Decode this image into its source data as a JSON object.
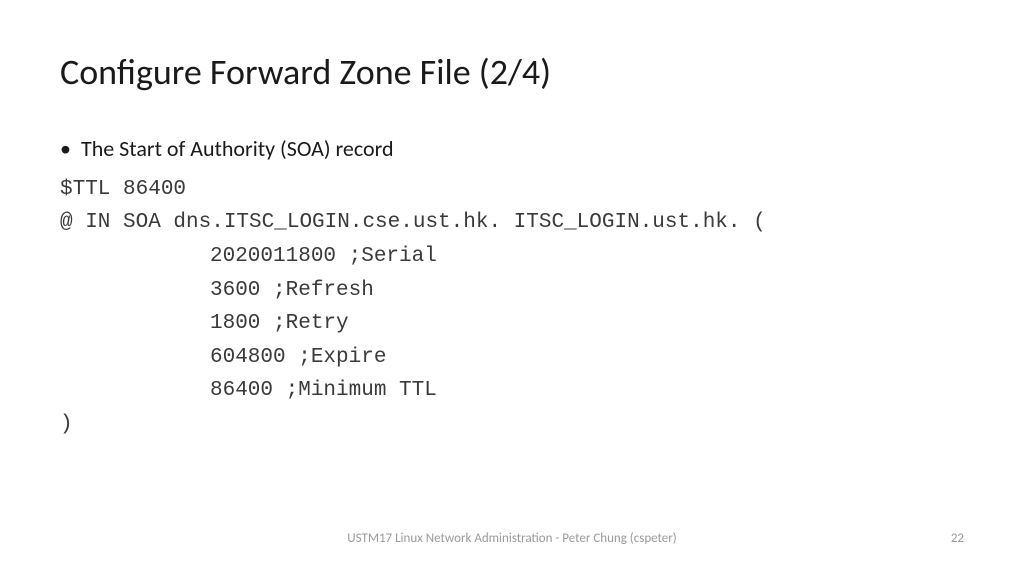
{
  "slide": {
    "title": "Configure Forward Zone File (2/4)",
    "bullet": "•",
    "bullet_text": "The Start of Authority (SOA) record",
    "code": {
      "line1": "$TTL 86400",
      "line2": "@ IN SOA dns.ITSC_LOGIN.cse.ust.hk. ITSC_LOGIN.ust.hk. (",
      "serial": "2020011800 ;Serial",
      "refresh": "3600 ;Refresh",
      "retry": "1800 ;Retry",
      "expire": "604800 ;Expire",
      "minttl": "86400 ;Minimum TTL",
      "close": ")"
    },
    "footer": "USTM17 Linux Network Administration - Peter Chung (cspeter)",
    "page_number": "22"
  }
}
